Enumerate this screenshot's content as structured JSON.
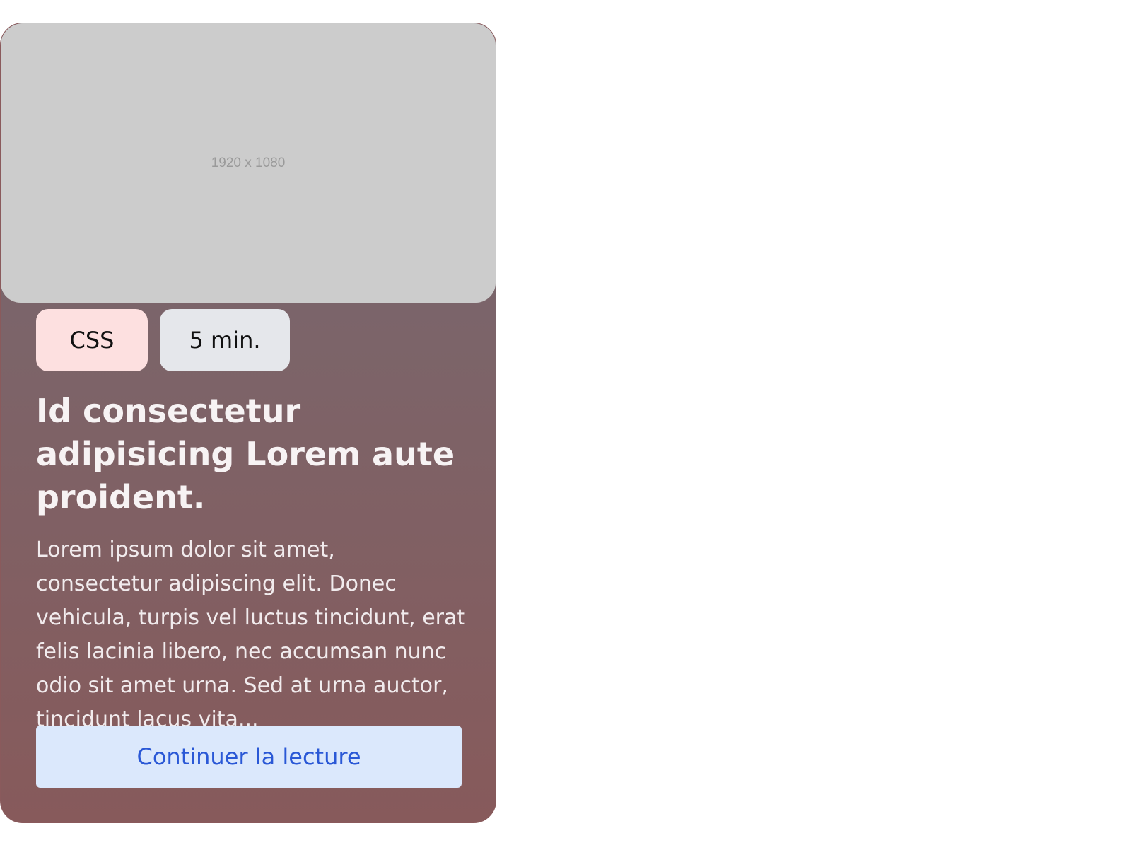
{
  "card": {
    "image_placeholder": "1920 x 1080",
    "tags": {
      "topic": "CSS",
      "reading_time": "5 min."
    },
    "title": "Id consectetur adipisicing Lorem aute proident.",
    "excerpt": "Lorem ipsum dolor sit amet, consectetur adipiscing elit. Donec vehicula, turpis vel luctus tincidunt, erat felis lacinia libero, nec accumsan nunc odio sit amet urna. Sed at urna auctor, tincidunt lacus vita...",
    "cta_label": "Continuer la lecture"
  },
  "colors": {
    "topic_tag_bg": "#fde0e0",
    "time_tag_bg": "#e5e7eb",
    "cta_bg": "#dbe8fc",
    "cta_text": "#2a58d6",
    "card_gradient_top": "#726871",
    "card_gradient_bottom": "#875a5b"
  }
}
